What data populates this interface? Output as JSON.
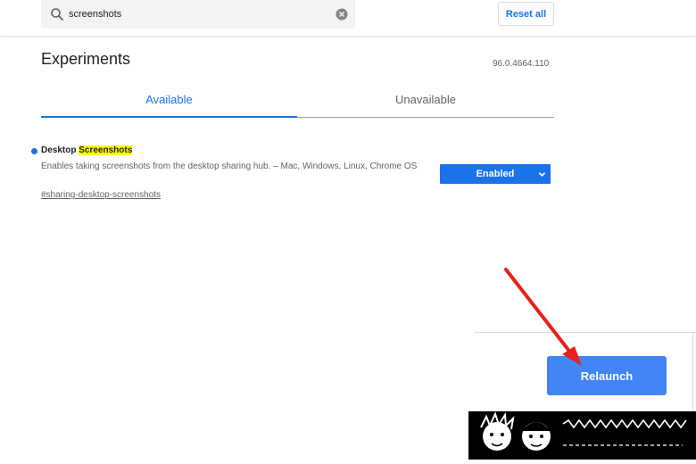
{
  "search": {
    "value": "screenshots",
    "placeholder": "Search flags"
  },
  "header": {
    "reset_label": "Reset all",
    "title": "Experiments",
    "version": "96.0.4664.110"
  },
  "tabs": [
    {
      "label": "Available",
      "active": true
    },
    {
      "label": "Unavailable",
      "active": false
    }
  ],
  "experiment": {
    "title_prefix": "Desktop ",
    "title_highlight": "Screenshots",
    "description": "Enables taking screenshots from the desktop sharing hub. – Mac, Windows, Linux, Chrome OS",
    "link": "#sharing-desktop-screenshots",
    "selected_option": "Enabled"
  },
  "relaunch": {
    "label": "Relaunch"
  },
  "colors": {
    "accent": "#1a73e8",
    "relaunch": "#4285f4",
    "highlight": "#ffff00",
    "arrow": "#e8201a"
  },
  "icons": [
    "search-icon",
    "clear-icon",
    "chevron-down-icon",
    "red-arrow"
  ]
}
